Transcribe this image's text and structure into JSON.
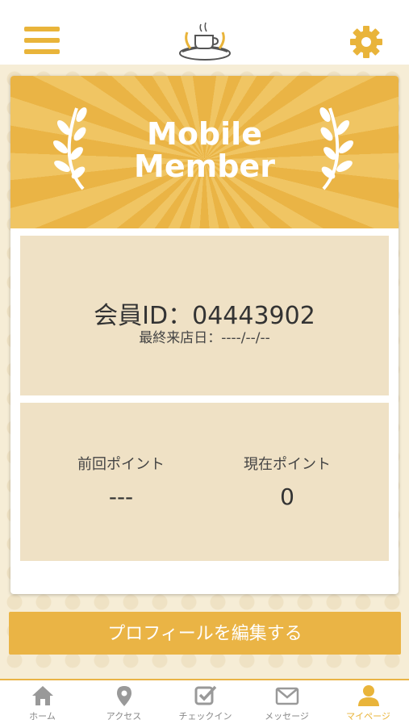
{
  "header": {
    "menu_icon": "hamburger-menu-icon",
    "logo_icon": "coffee-bread-logo",
    "settings_icon": "gear-icon"
  },
  "card": {
    "title_line1": "Mobile",
    "title_line2": "Member",
    "member_id": "会員ID：04443902",
    "last_visit": "最終来店日：----/--/--",
    "points": {
      "previous_label": "前回ポイント",
      "previous_value": "---",
      "current_label": "現在ポイント",
      "current_value": "0"
    }
  },
  "edit_profile_label": "プロフィールを編集する",
  "tabs": [
    {
      "label": "ホーム",
      "icon": "home-icon",
      "active": false
    },
    {
      "label": "アクセス",
      "icon": "map-pin-icon",
      "active": false
    },
    {
      "label": "チェックイン",
      "icon": "checkin-icon",
      "active": false
    },
    {
      "label": "メッセージ",
      "icon": "mail-icon",
      "active": false
    },
    {
      "label": "マイページ",
      "icon": "user-icon",
      "active": true
    }
  ],
  "colors": {
    "accent": "#e9b43a",
    "panel": "#efe1c5",
    "background": "#f6edd6"
  }
}
